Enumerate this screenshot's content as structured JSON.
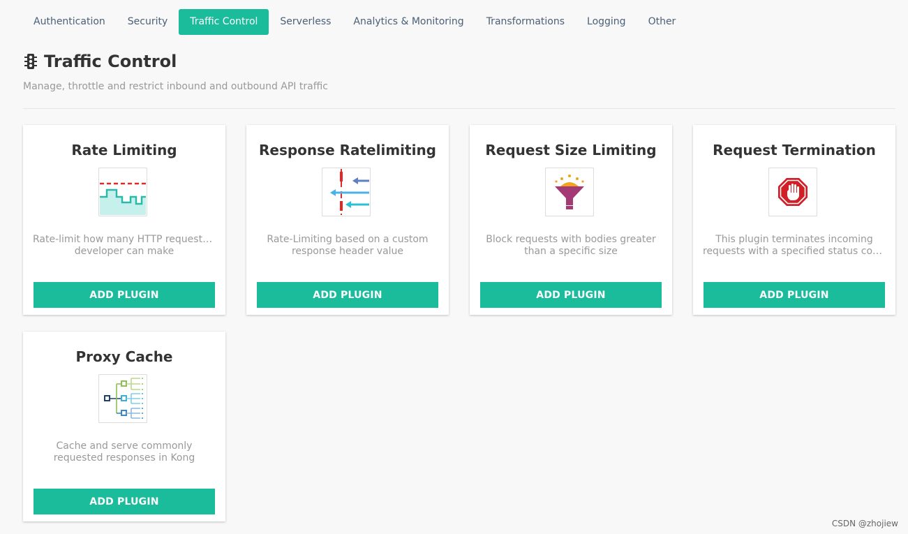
{
  "tabs": [
    {
      "label": "Authentication",
      "active": false
    },
    {
      "label": "Security",
      "active": false
    },
    {
      "label": "Traffic Control",
      "active": true
    },
    {
      "label": "Serverless",
      "active": false
    },
    {
      "label": "Analytics & Monitoring",
      "active": false
    },
    {
      "label": "Transformations",
      "active": false
    },
    {
      "label": "Logging",
      "active": false
    },
    {
      "label": "Other",
      "active": false
    }
  ],
  "header": {
    "icon": "traffic-light-icon",
    "title": "Traffic Control",
    "subtitle": "Manage, throttle and restrict inbound and outbound API traffic"
  },
  "plugins": [
    {
      "name": "Rate Limiting",
      "icon": "rate-limiting-icon",
      "desc_line1": "Rate-limit how many HTTP requests a",
      "desc_line2": "developer can make",
      "button": "ADD PLUGIN"
    },
    {
      "name": "Response Ratelimiting",
      "icon": "response-ratelimiting-icon",
      "desc_line1": "Rate-Limiting based on a custom",
      "desc_line2": "response header value",
      "button": "ADD PLUGIN"
    },
    {
      "name": "Request Size Limiting",
      "icon": "funnel-icon",
      "desc_line1": "Block requests with bodies greater",
      "desc_line2": "than a specific size",
      "button": "ADD PLUGIN"
    },
    {
      "name": "Request Termination",
      "icon": "stop-hand-icon",
      "desc_line1": "This plugin terminates incoming",
      "desc_line2": "requests with a specified status cod...",
      "button": "ADD PLUGIN"
    },
    {
      "name": "Proxy Cache",
      "icon": "cache-tree-icon",
      "desc_line1": "Cache and serve commonly",
      "desc_line2": "requested responses in Kong",
      "button": "ADD PLUGIN"
    }
  ],
  "colors": {
    "accent": "#1abc9c",
    "tab_text": "#4a6079"
  },
  "watermark": "CSDN @zhojiew"
}
